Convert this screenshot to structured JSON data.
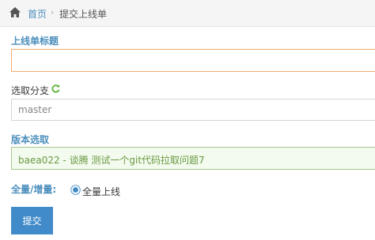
{
  "breadcrumb": {
    "home_icon": "home-icon",
    "home_label": "首页",
    "separator": "›",
    "current_label": "提交上线单"
  },
  "form": {
    "title_label": "上线单标题",
    "title_value": "",
    "branch_label": "选取分支",
    "branch_refresh_icon": "refresh-icon",
    "branch_value": "master",
    "version_label": "版本选取",
    "version_value": "baea022 - 谈腾 测试一个git代码拉取问题7",
    "mode_label": "全量/增量:",
    "mode_option_label": "全量上线",
    "mode_selected": true,
    "submit_label": "提交"
  },
  "colors": {
    "accent_blue": "#4c8fbd",
    "button_blue": "#428bca",
    "refresh_green": "#5fb13a",
    "version_green": "#6a9a42",
    "title_border_orange": "#f0ad6e"
  }
}
